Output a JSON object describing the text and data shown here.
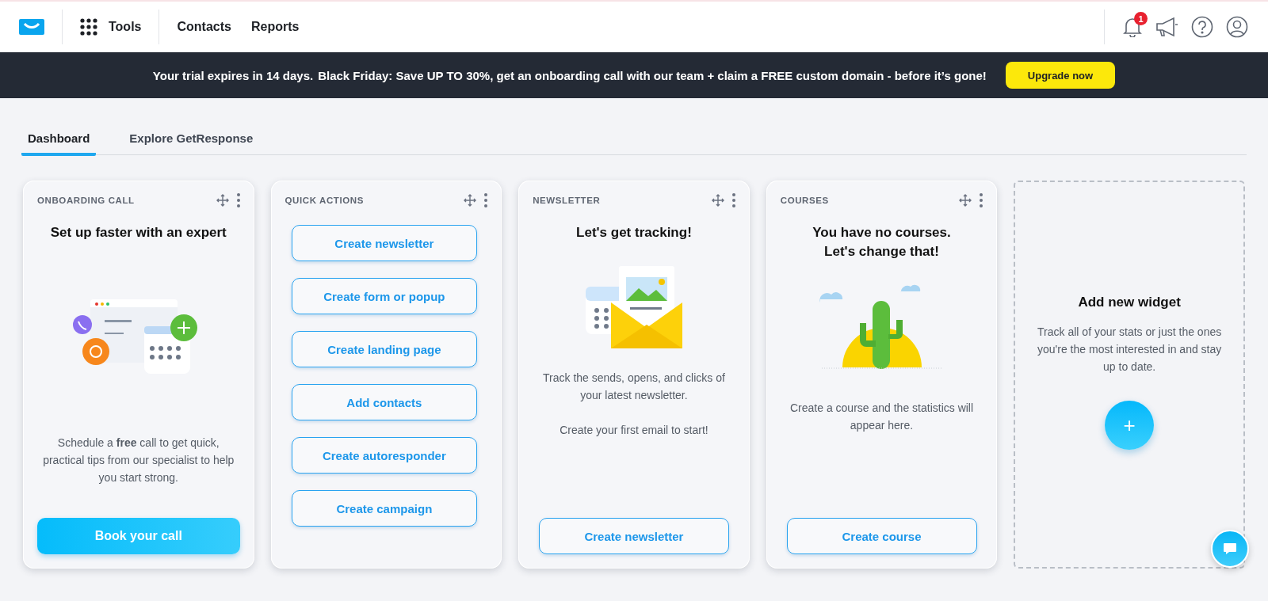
{
  "header": {
    "tools": "Tools",
    "nav": [
      {
        "label": "Contacts"
      },
      {
        "label": "Reports"
      }
    ],
    "notification_count": "1"
  },
  "banner": {
    "trial": "Your trial expires in 14 days.",
    "offer": "Black Friday: Save UP TO 30%, get an onboarding call with our team + claim a FREE custom domain - before it’s gone!",
    "button": "Upgrade now"
  },
  "tabs": [
    {
      "label": "Dashboard",
      "selected": true
    },
    {
      "label": "Explore GetResponse",
      "selected": false
    }
  ],
  "widgets": [
    {
      "kind": "onboarding",
      "title": "ONBOARDING CALL",
      "heading": "Set up faster with an expert",
      "text": "Schedule a **free** call to get quick, practical tips from our specialist to help you start strong.",
      "button": "Book your call"
    },
    {
      "kind": "actions",
      "title": "QUICK ACTIONS",
      "actions": [
        "Create newsletter",
        "Create form or popup",
        "Create landing page",
        "Add contacts",
        "Create autoresponder",
        "Create campaign"
      ]
    },
    {
      "kind": "newsletter",
      "title": "NEWSLETTER",
      "heading": "Let's get tracking!",
      "texts": [
        "Track the sends, opens, and clicks of your latest newsletter.",
        "Create your first email to start!"
      ],
      "button": "Create newsletter"
    },
    {
      "kind": "courses",
      "title": "COURSES",
      "heading": "You have no courses. Let's change that!",
      "texts": [
        "Create a course and the statistics will appear here."
      ],
      "button": "Create course"
    },
    {
      "kind": "add",
      "heading": "Add new widget",
      "text": "Track all of your stats or just the ones you're the most interested in and stay up to date.",
      "button": "+"
    }
  ]
}
